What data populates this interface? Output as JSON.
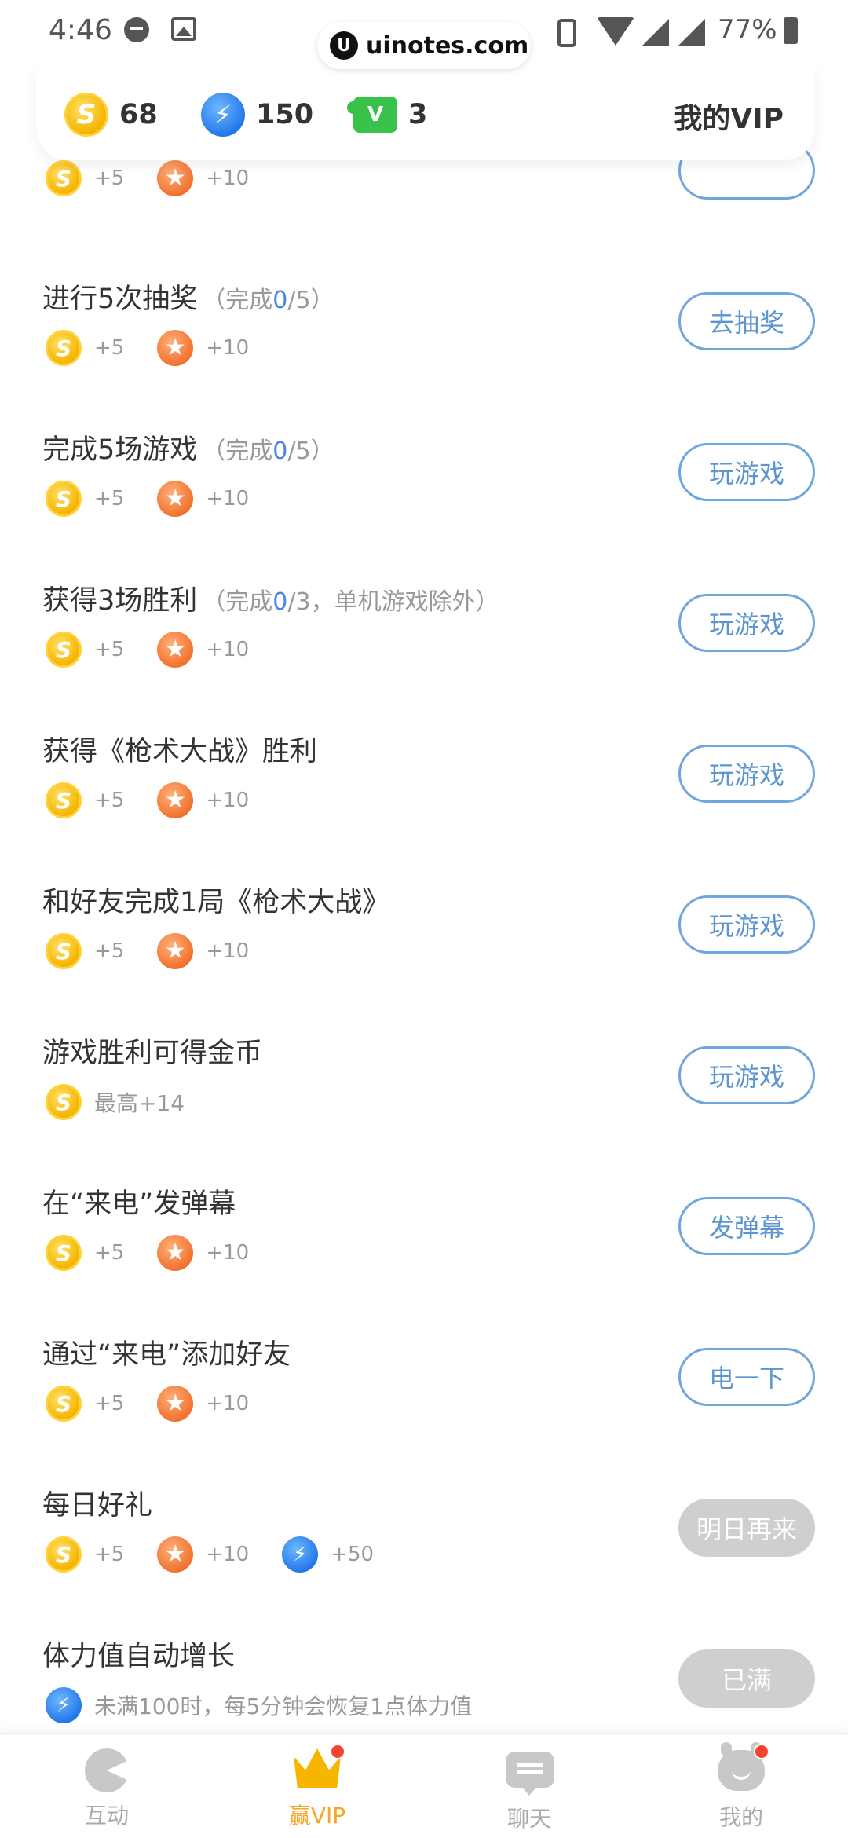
{
  "status_bar": {
    "time": "4:46",
    "url": "uinotes.com",
    "url_logo": "U",
    "battery": "77%"
  },
  "resources": {
    "coins": "68",
    "energy": "150",
    "puzzles": "3",
    "vip_link": "我的VIP"
  },
  "icons": {
    "coin_glyph": "S",
    "star_glyph": "★",
    "bolt_glyph": "⚡",
    "puzzle_glyph": "V"
  },
  "tasks": [
    {
      "title": "",
      "progress_prefix": "",
      "progress_done": "",
      "progress_suffix": "",
      "coin": "+5",
      "star": "+10",
      "button": ""
    },
    {
      "title": "进行5次抽奖",
      "progress_prefix": "（完成",
      "progress_done": "0",
      "progress_suffix": "/5）",
      "coin": "+5",
      "star": "+10",
      "button": "去抽奖"
    },
    {
      "title": "完成5场游戏",
      "progress_prefix": "（完成",
      "progress_done": "0",
      "progress_suffix": "/5）",
      "coin": "+5",
      "star": "+10",
      "button": "玩游戏"
    },
    {
      "title": "获得3场胜利",
      "progress_prefix": "（完成",
      "progress_done": "0",
      "progress_suffix": "/3，单机游戏除外）",
      "coin": "+5",
      "star": "+10",
      "button": "玩游戏"
    },
    {
      "title": "获得《枪术大战》胜利",
      "progress_prefix": "",
      "progress_done": "",
      "progress_suffix": "",
      "coin": "+5",
      "star": "+10",
      "button": "玩游戏"
    },
    {
      "title": "和好友完成1局《枪术大战》",
      "progress_prefix": "",
      "progress_done": "",
      "progress_suffix": "",
      "coin": "+5",
      "star": "+10",
      "button": "玩游戏"
    },
    {
      "title": "游戏胜利可得金币",
      "coin_desc": "最高+14",
      "button": "玩游戏"
    },
    {
      "title": "在“来电”发弹幕",
      "coin": "+5",
      "star": "+10",
      "button": "发弹幕"
    },
    {
      "title": "通过“来电”添加好友",
      "coin": "+5",
      "star": "+10",
      "button": "电一下"
    },
    {
      "title": "每日好礼",
      "coin": "+5",
      "star": "+10",
      "bolt": "+50",
      "button": "明日再来"
    },
    {
      "title": "体力值自动增长",
      "bolt_desc": "未满100时，每5分钟会恢复1点体力值",
      "button": "已满"
    }
  ],
  "bottom_nav": [
    {
      "label": "互动"
    },
    {
      "label": "赢VIP"
    },
    {
      "label": "聊天"
    },
    {
      "label": "我的"
    }
  ],
  "colors": {
    "accent_blue": "#5c95cf",
    "nav_active": "#f5a623",
    "badge_red": "#f4432f"
  }
}
